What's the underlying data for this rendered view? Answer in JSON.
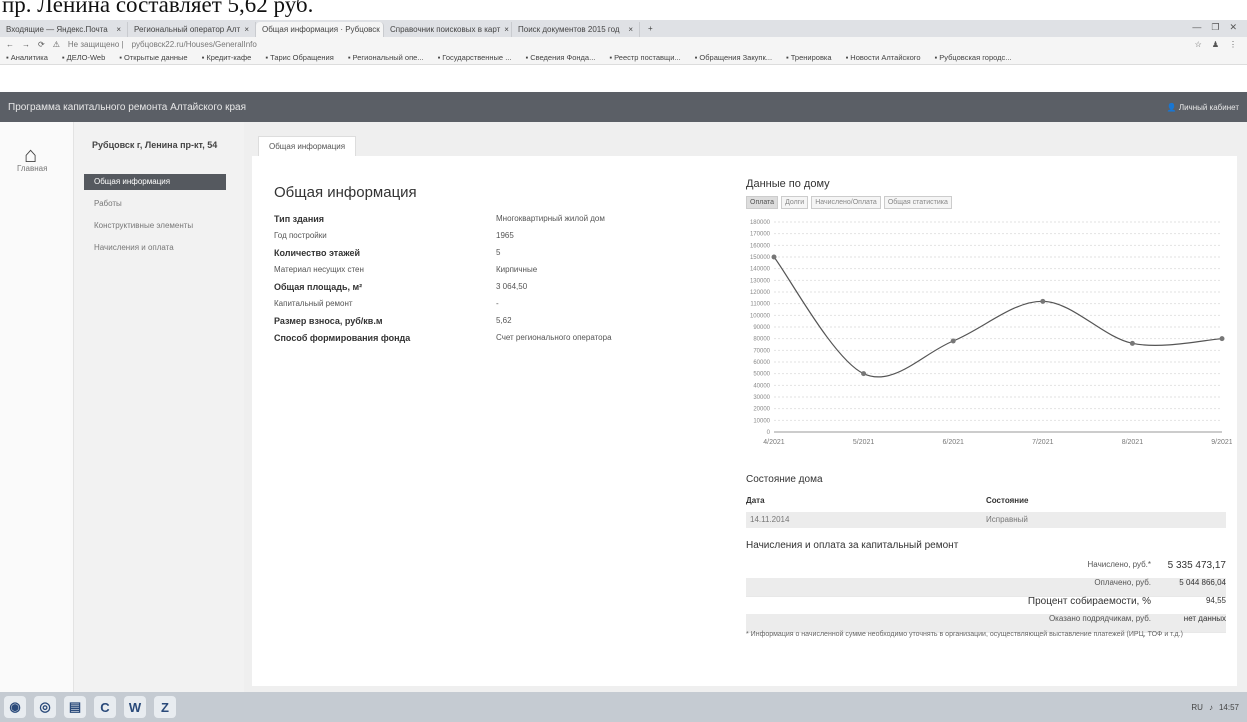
{
  "caption": "пр. Ленина составляет 5,62 руб.",
  "browser": {
    "tabs": [
      {
        "label": "Входящие — Яндекс.Почта",
        "active": false
      },
      {
        "label": "Региональный оператор Алт",
        "active": false
      },
      {
        "label": "Общая информация · Рубцовск",
        "active": true
      },
      {
        "label": "Справочник поисковых в карт",
        "active": false
      },
      {
        "label": "Поиск документов 2015 год",
        "active": false
      }
    ],
    "new_tab": "+",
    "window_controls": [
      "—",
      "❐",
      "✕"
    ],
    "url_prefix": "Не защищено |",
    "url": "рубцовск22.ru/Houses/GeneralInfo",
    "bookmarks": [
      "Аналитика",
      "ДЕЛО-Web",
      "Открытые данные",
      "Кредит-кафе",
      "Тарис Обращения",
      "Региональный опе...",
      "Государственные ...",
      "Сведения Фонда...",
      "Реестр поставщи...",
      "Обращения Закупк...",
      "Тренировка",
      "Новости Алтайского",
      "Рубцовская городс..."
    ]
  },
  "app": {
    "title": "Программа капитального ремонта Алтайского края",
    "user_link": "Личный кабинет",
    "home_label": "Главная",
    "address": "Рубцовск г, Ленина пр-кт, 54",
    "nav": [
      {
        "label": "Общая информация",
        "active": true
      },
      {
        "label": "Работы",
        "active": false
      },
      {
        "label": "Конструктивные элементы",
        "active": false
      },
      {
        "label": "Начисления и оплата",
        "active": false
      }
    ],
    "content_tab": "Общая информация"
  },
  "general_info": {
    "title": "Общая информация",
    "rows": [
      {
        "label": "Тип здания",
        "value": "Многоквартирный жилой дом",
        "bold": true
      },
      {
        "label": "Год постройки",
        "value": "1965",
        "bold": false
      },
      {
        "label": "Количество этажей",
        "value": "5",
        "bold": true
      },
      {
        "label": "Материал несущих стен",
        "value": "Кирпичные",
        "bold": false
      },
      {
        "label": "Общая площадь, м²",
        "value": "3 064,50",
        "bold": true
      },
      {
        "label": "Капитальный ремонт",
        "value": "-",
        "bold": false
      },
      {
        "label": "Размер взноса, руб/кв.м",
        "value": "5,62",
        "bold": true
      },
      {
        "label": "Способ формирования фонда",
        "value": "Счет регионального оператора",
        "bold": true
      }
    ]
  },
  "house_data": {
    "title": "Данные по дому",
    "tabs": [
      {
        "label": "Оплата",
        "active": true
      },
      {
        "label": "Долги",
        "active": false
      },
      {
        "label": "Начислено/Оплата",
        "active": false
      },
      {
        "label": "Общая статистика",
        "active": false
      }
    ]
  },
  "chart_data": {
    "type": "line",
    "x": [
      "4/2021",
      "5/2021",
      "6/2021",
      "7/2021",
      "8/2021",
      "9/2021"
    ],
    "y_ticks": [
      0,
      10000,
      20000,
      30000,
      40000,
      50000,
      60000,
      70000,
      80000,
      90000,
      100000,
      110000,
      120000,
      130000,
      140000,
      150000,
      160000,
      170000,
      180000
    ],
    "ylim": [
      0,
      180000
    ],
    "series": [
      {
        "values": [
          150000,
          50000,
          78000,
          112000,
          76000,
          80000
        ]
      }
    ],
    "grid": true,
    "colors": {
      "line": "#555555",
      "point": "#777777"
    }
  },
  "state": {
    "title": "Состояние дома",
    "columns": [
      "Дата",
      "Состояние"
    ],
    "rows": [
      [
        "14.11.2014",
        "Исправный"
      ]
    ]
  },
  "charges": {
    "title": "Начисления и оплата за капитальный ремонт",
    "rows": [
      {
        "label": "Начислено, руб.*",
        "value": "5 335 473,17"
      },
      {
        "label": "Оплачено, руб.",
        "value": "5 044 866,04"
      },
      {
        "label": "Процент собираемости, %",
        "value": "94,55"
      },
      {
        "label": "Оказано подрядчикам, руб.",
        "value": "нет данных"
      }
    ],
    "footnote": "* Информация о начисленной сумме необходимо уточнять в организации, осуществляющей выставление платежей (ИРЦ, ТОФ и т.д.)"
  },
  "taskbar": {
    "apps": [
      "◉",
      "◎",
      "▤",
      "C",
      "W",
      "Z"
    ],
    "tray_lang": "RU",
    "time": "14:57"
  }
}
